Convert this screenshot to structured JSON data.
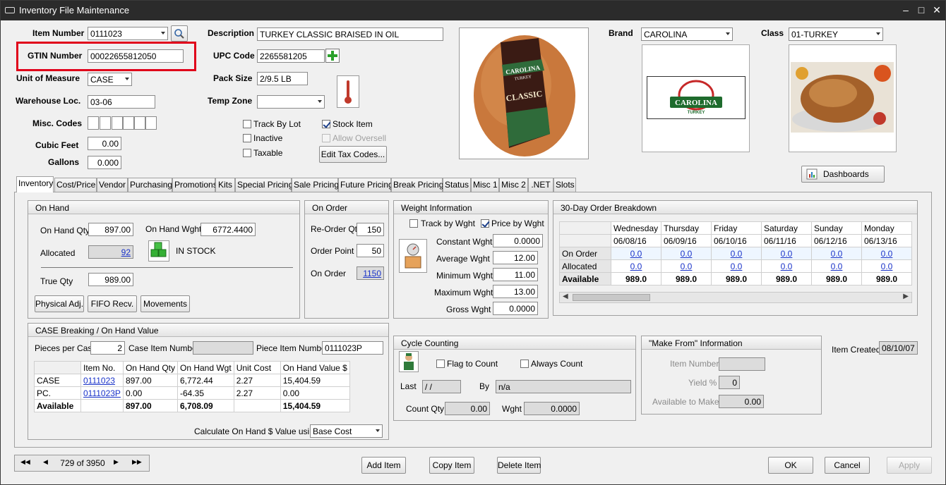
{
  "window": {
    "title": "Inventory File Maintenance"
  },
  "header": {
    "item_number_label": "Item Number",
    "item_number": "0111023",
    "gtin_label": "GTIN Number",
    "gtin": "00022655812050",
    "uom_label": "Unit of Measure",
    "uom": "CASE",
    "warehouse_label": "Warehouse Loc.",
    "warehouse": "03-06",
    "misc_codes_label": "Misc. Codes",
    "cubic_feet_label": "Cubic Feet",
    "cubic_feet": "0.00",
    "gallons_label": "Gallons",
    "gallons": "0.000",
    "description_label": "Description",
    "description": "TURKEY CLASSIC BRAISED IN OIL",
    "upc_label": "UPC Code",
    "upc": "2265581205",
    "pack_size_label": "Pack Size",
    "pack_size": "2/9.5 LB",
    "temp_zone_label": "Temp Zone",
    "temp_zone": "",
    "track_by_lot": "Track By Lot",
    "inactive": "Inactive",
    "taxable": "Taxable",
    "stock_item": "Stock Item",
    "allow_oversell": "Allow Oversell",
    "edit_tax_codes": "Edit Tax Codes...",
    "brand_label": "Brand",
    "brand": "CAROLINA",
    "class_label": "Class",
    "class": "01-TURKEY",
    "dashboards": "Dashboards",
    "product_label_line1": "CAROLINA",
    "product_label_line2": "TURKEY",
    "product_label_line3": "CLASSIC",
    "logo_line1": "CAROLINA",
    "logo_line2": "TURKEY"
  },
  "tabs": [
    "Inventory",
    "Cost/Price",
    "Vendor",
    "Purchasing",
    "Promotions",
    "Kits",
    "Special Pricing",
    "Sale Pricing",
    "Future Pricing",
    "Break Pricing",
    "Status",
    "Misc 1",
    "Misc 2",
    ".NET",
    "Slots"
  ],
  "on_hand": {
    "title": "On Hand",
    "on_hand_qty_label": "On Hand Qty",
    "on_hand_qty": "897.00",
    "on_hand_wght_label": "On Hand Wght",
    "on_hand_wght": "6772.4400",
    "allocated_label": "Allocated",
    "allocated": "92",
    "status": "IN STOCK",
    "true_qty_label": "True Qty",
    "true_qty": "989.00",
    "physical_adj": "Physical Adj.",
    "fifo_recv": "FIFO Recv.",
    "movements": "Movements"
  },
  "on_order": {
    "title": "On Order",
    "reorder_qty_label": "Re-Order Qty",
    "reorder_qty": "150",
    "order_point_label": "Order Point",
    "order_point": "50",
    "on_order_label": "On Order",
    "on_order": "1150"
  },
  "weight": {
    "title": "Weight Information",
    "track_by_wght": "Track by Wght",
    "price_by_wght": "Price by Wght",
    "constant_label": "Constant Wght",
    "constant": "0.0000",
    "average_label": "Average Wght",
    "average": "12.00",
    "minimum_label": "Minimum Wght",
    "minimum": "11.00",
    "maximum_label": "Maximum Wght",
    "maximum": "13.00",
    "gross_label": "Gross Wght",
    "gross": "0.0000"
  },
  "breakdown": {
    "title": "30-Day Order Breakdown",
    "days": [
      {
        "day": "Wednesday",
        "date": "06/08/16",
        "on_order": "0.0",
        "allocated": "0.0",
        "available": "989.0"
      },
      {
        "day": "Thursday",
        "date": "06/09/16",
        "on_order": "0.0",
        "allocated": "0.0",
        "available": "989.0"
      },
      {
        "day": "Friday",
        "date": "06/10/16",
        "on_order": "0.0",
        "allocated": "0.0",
        "available": "989.0"
      },
      {
        "day": "Saturday",
        "date": "06/11/16",
        "on_order": "0.0",
        "allocated": "0.0",
        "available": "989.0"
      },
      {
        "day": "Sunday",
        "date": "06/12/16",
        "on_order": "0.0",
        "allocated": "0.0",
        "available": "989.0"
      },
      {
        "day": "Monday",
        "date": "06/13/16",
        "on_order": "0.0",
        "allocated": "0.0",
        "available": "989.0"
      }
    ],
    "row_labels": [
      "On Order",
      "Allocated",
      "Available"
    ]
  },
  "breaking": {
    "title": "CASE Breaking / On Hand Value",
    "pieces_label": "Pieces per Case",
    "pieces": "2",
    "case_item_label": "Case Item Number",
    "case_item": "",
    "piece_item_label": "Piece Item Number",
    "piece_item": "0111023P",
    "columns": [
      "Item No.",
      "On Hand Qty",
      "On Hand Wgt",
      "Unit Cost",
      "On Hand Value $"
    ],
    "rows": [
      {
        "label": "CASE",
        "item": "0111023",
        "qty": "897.00",
        "wgt": "6,772.44",
        "cost": "2.27",
        "value": "15,404.59"
      },
      {
        "label": "PC.",
        "item": "0111023P",
        "qty": "0.00",
        "wgt": "-64.35",
        "cost": "2.27",
        "value": "0.00"
      },
      {
        "label": "Available",
        "item": "",
        "qty": "897.00",
        "wgt": "6,708.09",
        "cost": "",
        "value": "15,404.59"
      }
    ],
    "calc_label": "Calculate On Hand $ Value using:",
    "calc": "Base Cost"
  },
  "cycle": {
    "title": "Cycle Counting",
    "flag": "Flag to Count",
    "always": "Always Count",
    "last_label": "Last",
    "last": "/ /",
    "by_label": "By",
    "by": "n/a",
    "count_qty_label": "Count Qty",
    "count_qty": "0.00",
    "wght_label": "Wght",
    "wght": "0.0000"
  },
  "make_from": {
    "title": "\"Make From\" Information",
    "item_label": "Item Number",
    "item": "",
    "yield_label": "Yield %",
    "yield": "0",
    "avail_label": "Available to Make",
    "avail": "0.00"
  },
  "item_created": {
    "label": "Item Created:",
    "value": "08/10/07"
  },
  "nav": {
    "record": "729 of 3950"
  },
  "footer": {
    "add": "Add Item",
    "copy": "Copy Item",
    "delete": "Delete Item",
    "ok": "OK",
    "cancel": "Cancel",
    "apply": "Apply"
  },
  "colors": {
    "highlight": "#e0001a",
    "link": "#1a33c9",
    "title_bg": "#2b2b2b"
  }
}
